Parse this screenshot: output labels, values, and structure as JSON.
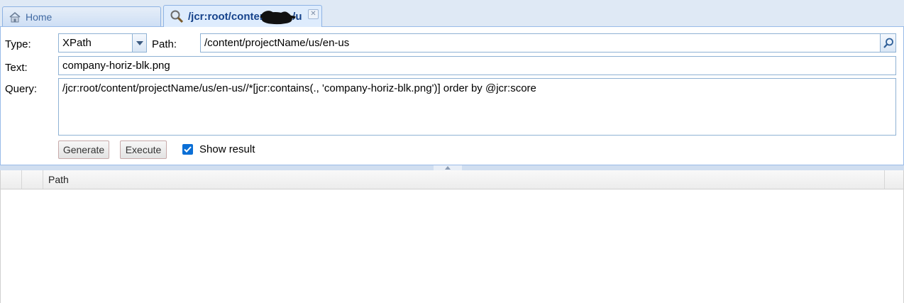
{
  "tabs": [
    {
      "label": "Home",
      "icon": "home-icon"
    },
    {
      "label": "/jcr:root/content/",
      "label_tail": "/u",
      "icon": "search-icon"
    }
  ],
  "form": {
    "type_label": "Type:",
    "type_value": "XPath",
    "path_label": "Path:",
    "path_value": "/content/projectName/us/en-us",
    "text_label": "Text:",
    "text_value": "company-horiz-blk.png",
    "query_label": "Query:",
    "query_value": "/jcr:root/content/projectName/us/en-us//*[jcr:contains(., 'company-horiz-blk.png')] order by @jcr:score",
    "generate_label": "Generate",
    "execute_label": "Execute",
    "show_result_label": "Show result",
    "show_result_checked": true
  },
  "results": {
    "columns": [
      "",
      "",
      "Path"
    ],
    "rows": []
  },
  "colors": {
    "accent": "#15428b",
    "border": "#99bbe8",
    "checkbox": "#0b6fd6"
  }
}
